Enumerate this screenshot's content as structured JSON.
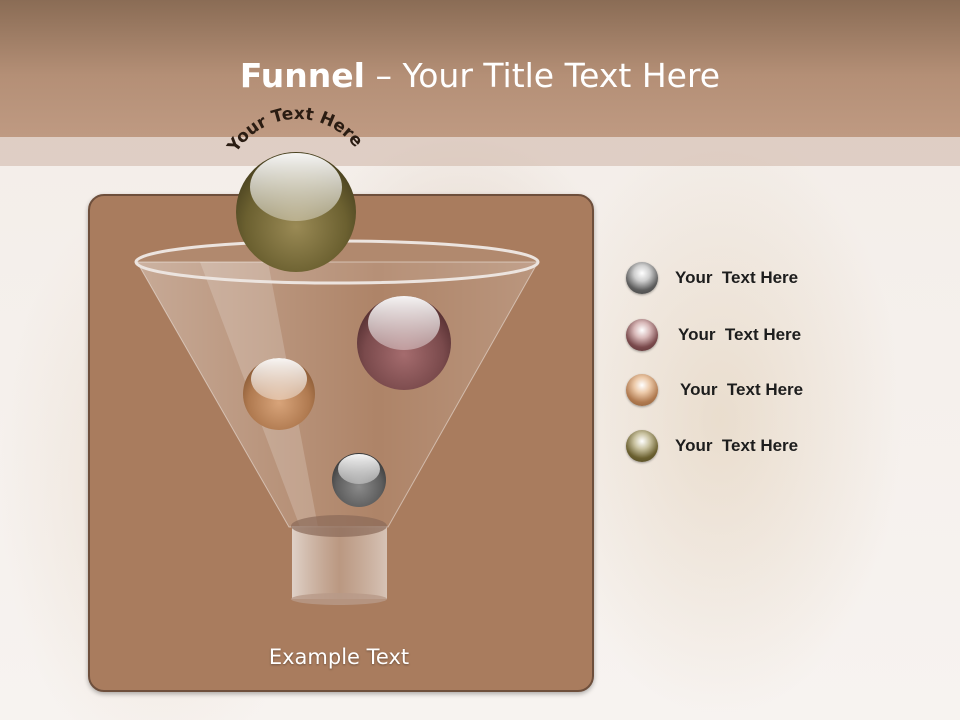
{
  "header": {
    "title_bold": "Funnel",
    "title_rest": " – Your Title Text Here"
  },
  "funnel": {
    "arc_label": "Your Text Here",
    "bottom_label": "Example Text"
  },
  "legend": {
    "items": [
      {
        "label": "Your  Text Here",
        "color": "#5e5e5e"
      },
      {
        "label": "Your  Text Here",
        "color": "#7a4a4c"
      },
      {
        "label": "Your  Text Here",
        "color": "#b07a50"
      },
      {
        "label": "Your  Text Here",
        "color": "#6b6030"
      }
    ]
  },
  "colors": {
    "panel": "#a97c5e",
    "title_bar": "#b48f76",
    "ball_top": "#6b6030",
    "ball_gray": "#5e5e5e",
    "ball_maroon": "#7a4a4c",
    "ball_orange": "#b07a50"
  }
}
